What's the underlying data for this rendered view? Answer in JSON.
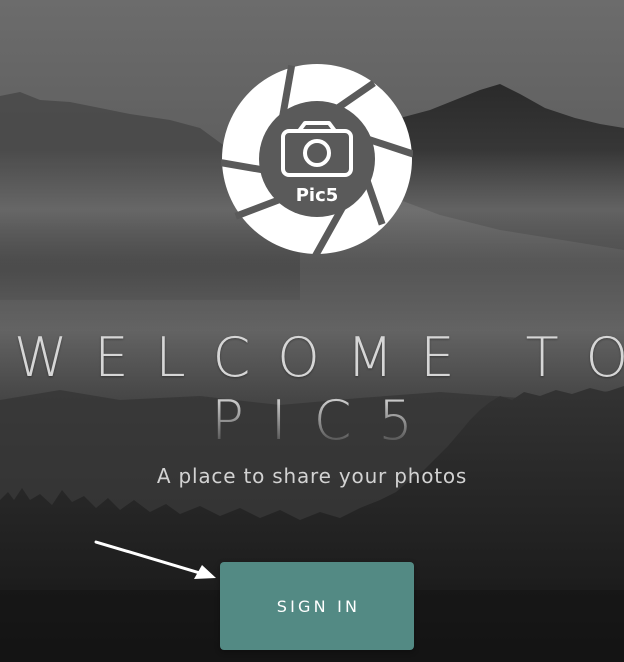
{
  "logo": {
    "text": "Pic5",
    "icon": "camera-aperture-logo"
  },
  "hero": {
    "welcome": "WELCOME TO",
    "brand": "PIC5",
    "tagline": "A place to share your photos"
  },
  "signin": {
    "label": "SIGN IN"
  },
  "colors": {
    "button": "#538a84",
    "text": "#d6d6d6"
  }
}
